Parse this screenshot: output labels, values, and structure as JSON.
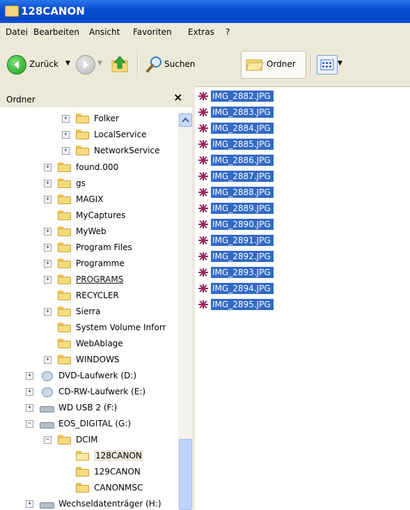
{
  "window": {
    "title": "128CANON"
  },
  "menu": [
    "Datei",
    "Bearbeiten",
    "Ansicht",
    "Favoriten",
    "Extras",
    "?"
  ],
  "toolbar": {
    "back": "Zurück",
    "search": "Suchen",
    "folders": "Ordner"
  },
  "sidebar": {
    "title": "Ordner",
    "close": "×"
  },
  "tree": [
    {
      "label": "Folker",
      "expander": "+"
    },
    {
      "label": "LocalService",
      "expander": "+"
    },
    {
      "label": "NetworkService",
      "expander": "+"
    },
    {
      "label": "found.000",
      "expander": "+"
    },
    {
      "label": "gs",
      "expander": "+"
    },
    {
      "label": "MAGIX",
      "expander": "+"
    },
    {
      "label": "MyCaptures",
      "expander": ""
    },
    {
      "label": "MyWeb",
      "expander": "+"
    },
    {
      "label": "Program Files",
      "expander": "+"
    },
    {
      "label": "Programme",
      "expander": "+"
    },
    {
      "label": "PROGRAMS",
      "expander": "+"
    },
    {
      "label": "RECYCLER",
      "expander": ""
    },
    {
      "label": "Sierra",
      "expander": "+"
    },
    {
      "label": "System Volume Inforr",
      "expander": ""
    },
    {
      "label": "WebAblage",
      "expander": ""
    },
    {
      "label": "WINDOWS",
      "expander": "+"
    },
    {
      "label": "DVD-Laufwerk (D:)",
      "expander": "+"
    },
    {
      "label": "CD-RW-Laufwerk (E:)",
      "expander": "+"
    },
    {
      "label": "WD USB 2 (F:)",
      "expander": "+"
    },
    {
      "label": "EOS_DIGITAL (G:)",
      "expander": "−"
    },
    {
      "label": "DCIM",
      "expander": "−"
    },
    {
      "label": "128CANON",
      "expander": ""
    },
    {
      "label": "129CANON",
      "expander": ""
    },
    {
      "label": "CANONMSC",
      "expander": ""
    },
    {
      "label": "Wechseldatenträger (H:)",
      "expander": "+"
    }
  ],
  "files": [
    "IMG_2882.JPG",
    "IMG_2883.JPG",
    "IMG_2884.JPG",
    "IMG_2885.JPG",
    "IMG_2886.JPG",
    "IMG_2887.JPG",
    "IMG_2888.JPG",
    "IMG_2889.JPG",
    "IMG_2890.JPG",
    "IMG_2891.JPG",
    "IMG_2892.JPG",
    "IMG_2893.JPG",
    "IMG_2894.JPG",
    "IMG_2895.JPG"
  ],
  "colors": {
    "titlebar": "#0a4fd4",
    "selection": "#316ac5",
    "chrome": "#ece9d8"
  }
}
